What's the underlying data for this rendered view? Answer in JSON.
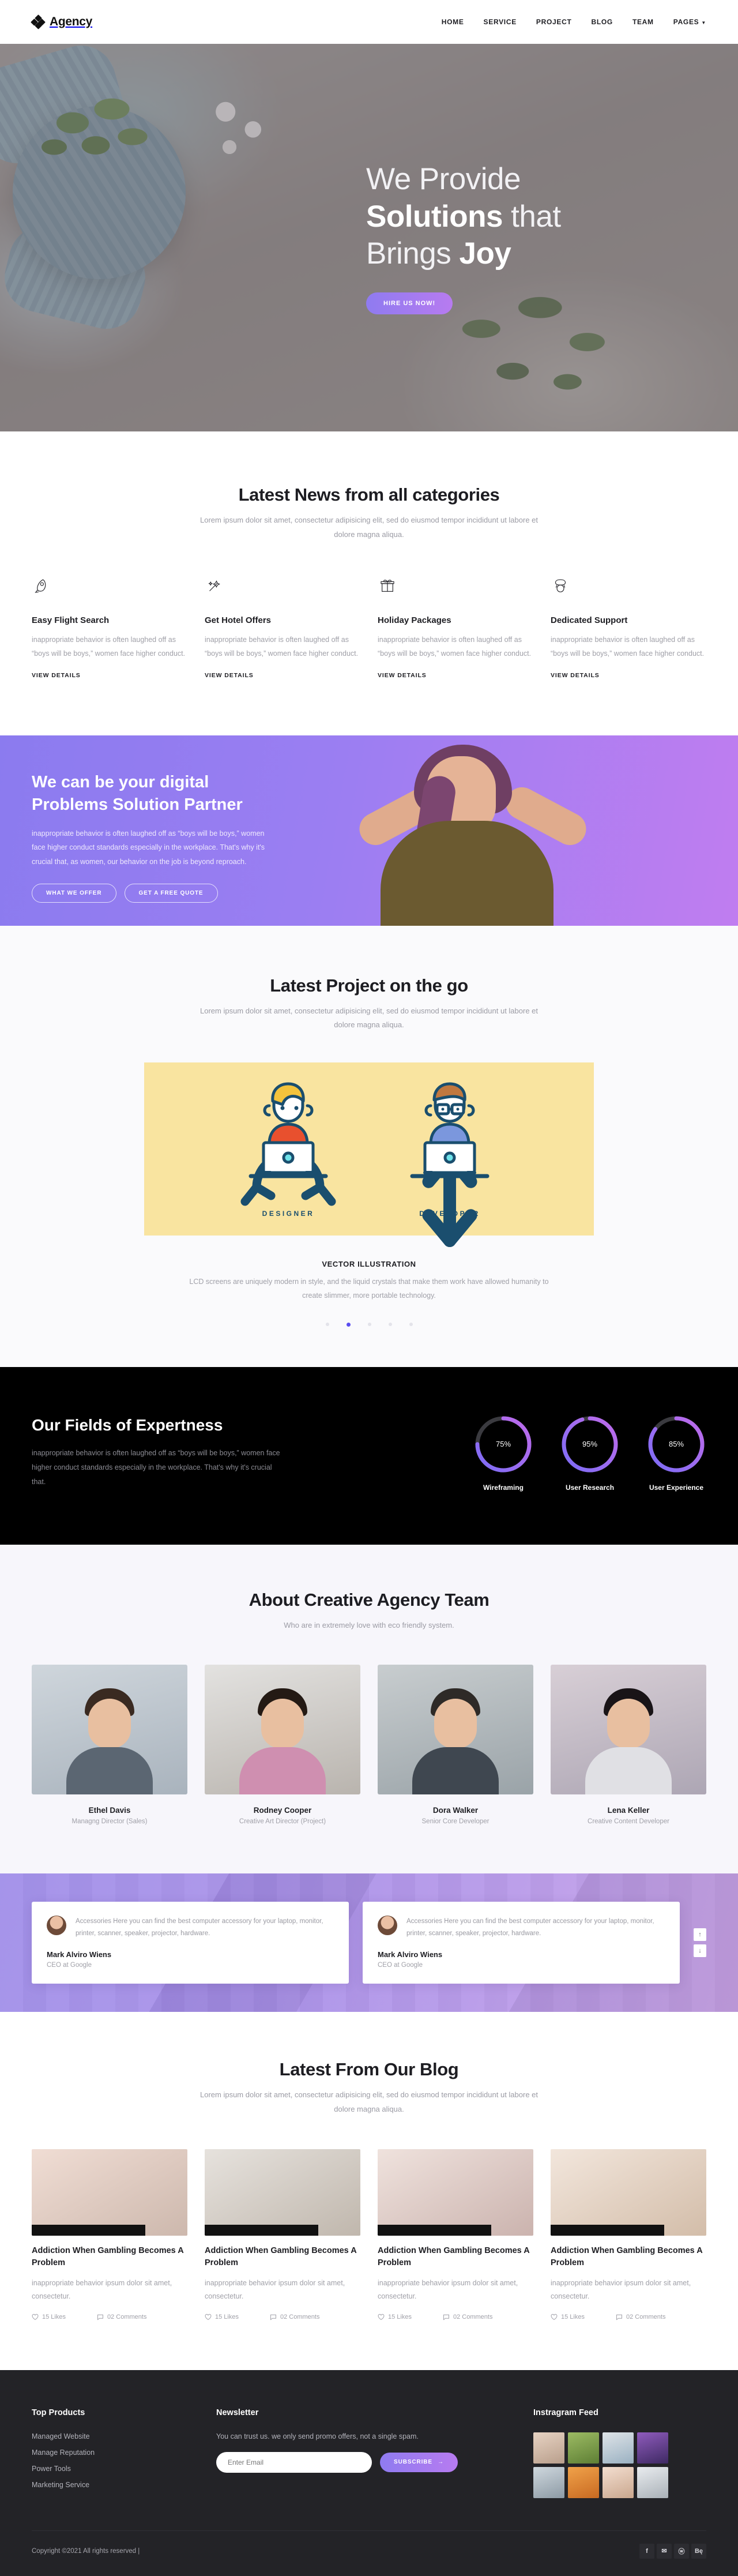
{
  "header": {
    "brand": "Agency",
    "nav": [
      {
        "label": "HOME"
      },
      {
        "label": "SERVICE"
      },
      {
        "label": "PROJECT"
      },
      {
        "label": "BLOG"
      },
      {
        "label": "TEAM"
      },
      {
        "label": "PAGES"
      }
    ]
  },
  "hero": {
    "line1": "We Provide",
    "line2_bold": "Solutions",
    "line2_rest": "that",
    "line3_rest": "Brings",
    "line3_bold": "Joy",
    "button": "HIRE US NOW!"
  },
  "news": {
    "title": "Latest News from all categories",
    "subtitle": "Lorem ipsum dolor sit amet, consectetur adipisicing elit, sed do eiusmod tempor incididunt ut labore et dolore magna aliqua.",
    "cards": [
      {
        "icon": "rocket-icon",
        "title": "Easy Flight Search",
        "text": "inappropriate behavior is often laughed off as “boys will be boys,” women face higher conduct.",
        "link": "VIEW DETAILS"
      },
      {
        "icon": "magic-wand-icon",
        "title": "Get Hotel Offers",
        "text": "inappropriate behavior is often laughed off as “boys will be boys,” women face higher conduct.",
        "link": "VIEW DETAILS"
      },
      {
        "icon": "gift-icon",
        "title": "Holiday Packages",
        "text": "inappropriate behavior is often laughed off as “boys will be boys,” women face higher conduct.",
        "link": "VIEW DETAILS"
      },
      {
        "icon": "telephone-icon",
        "title": "Dedicated Support",
        "text": "inappropriate behavior is often laughed off as “boys will be boys,” women face higher conduct.",
        "link": "VIEW DETAILS"
      }
    ]
  },
  "cta": {
    "title_line1": "We can be your digital",
    "title_line2": "Problems Solution Partner",
    "text": "inappropriate behavior is often laughed off as “boys will be boys,” women face higher conduct standards especially in the workplace. That's why it's crucial that, as women, our behavior on the job is beyond reproach.",
    "btn1": "WHAT WE OFFER",
    "btn2": "GET A FREE QUOTE"
  },
  "project": {
    "title": "Latest Project on the go",
    "subtitle": "Lorem ipsum dolor sit amet, consectetur adipisicing elit, sed do eiusmod tempor incididunt ut labore et dolore magna aliqua.",
    "slide": {
      "left_role": "DESIGNER",
      "right_role": "DEVELOPER",
      "caption_title": "VECTOR ILLUSTRATION",
      "caption_text": "LCD screens are uniquely modern in style, and the liquid crystals that make them work have allowed humanity to create slimmer, more portable technology."
    },
    "dots": 5,
    "active_dot": 1
  },
  "expert": {
    "title": "Our Fields of Expertness",
    "text": "inappropriate behavior is often laughed off as “boys will be boys,” women face higher conduct standards especially in the workplace. That's why it's crucial that.",
    "skills": [
      {
        "label": "Wireframing",
        "value": 75,
        "display": "75%"
      },
      {
        "label": "User Research",
        "value": 95,
        "display": "95%"
      },
      {
        "label": "User Experience",
        "value": 85,
        "display": "85%"
      }
    ]
  },
  "team": {
    "title": "About Creative Agency Team",
    "subtitle": "Who are in extremely love with eco friendly system.",
    "members": [
      {
        "name": "Ethel Davis",
        "role": "Managng Director (Sales)"
      },
      {
        "name": "Rodney Cooper",
        "role": "Creative Art Director (Project)"
      },
      {
        "name": "Dora Walker",
        "role": "Senior Core Developer"
      },
      {
        "name": "Lena Keller",
        "role": "Creative Content Developer"
      }
    ]
  },
  "testimonials": [
    {
      "text": "Accessories Here you can find the best computer accessory for your laptop, monitor, printer, scanner, speaker, projector, hardware.",
      "name": "Mark Alviro Wiens",
      "role": "CEO at Google"
    },
    {
      "text": "Accessories Here you can find the best computer accessory for your laptop, monitor, printer, scanner, speaker, projector, hardware.",
      "name": "Mark Alviro Wiens",
      "role": "CEO at Google"
    }
  ],
  "blog": {
    "title": "Latest From Our Blog",
    "subtitle": "Lorem ipsum dolor sit amet, consectetur adipisicing elit, sed do eiusmod tempor incididunt ut labore et dolore magna aliqua.",
    "posts": [
      {
        "title": "Addiction When Gambling Becomes A Problem",
        "text": "inappropriate behavior ipsum dolor sit amet, consectetur.",
        "likes": "15 Likes",
        "comments": "02 Comments"
      },
      {
        "title": "Addiction When Gambling Becomes A Problem",
        "text": "inappropriate behavior ipsum dolor sit amet, consectetur.",
        "likes": "15 Likes",
        "comments": "02 Comments"
      },
      {
        "title": "Addiction When Gambling Becomes A Problem",
        "text": "inappropriate behavior ipsum dolor sit amet, consectetur.",
        "likes": "15 Likes",
        "comments": "02 Comments"
      },
      {
        "title": "Addiction When Gambling Becomes A Problem",
        "text": "inappropriate behavior ipsum dolor sit amet, consectetur.",
        "likes": "15 Likes",
        "comments": "02 Comments"
      }
    ]
  },
  "footer": {
    "products_title": "Top Products",
    "products": [
      {
        "label": "Managed Website"
      },
      {
        "label": "Manage Reputation"
      },
      {
        "label": "Power Tools"
      },
      {
        "label": "Marketing Service"
      }
    ],
    "newsletter_title": "Newsletter",
    "newsletter_note": "You can trust us. we only send promo offers, not a single spam.",
    "email_placeholder": "Enter Email",
    "subscribe_label": "SUBSCRIBE",
    "instagram_title": "Instragram Feed",
    "copyright": "Copyright ©2021 All rights reserved |",
    "socials": [
      {
        "label": "f",
        "name": "facebook-icon"
      },
      {
        "label": "✉",
        "name": "twitter-icon"
      },
      {
        "label": "ⓦ",
        "name": "dribbble-icon"
      },
      {
        "label": "Bę",
        "name": "behance-icon"
      }
    ]
  },
  "colors": {
    "accent_start": "#8f7bf0",
    "accent_end": "#b77bf0",
    "dark": "#232327",
    "black": "#000000",
    "yellow": "#f9e4a0"
  }
}
